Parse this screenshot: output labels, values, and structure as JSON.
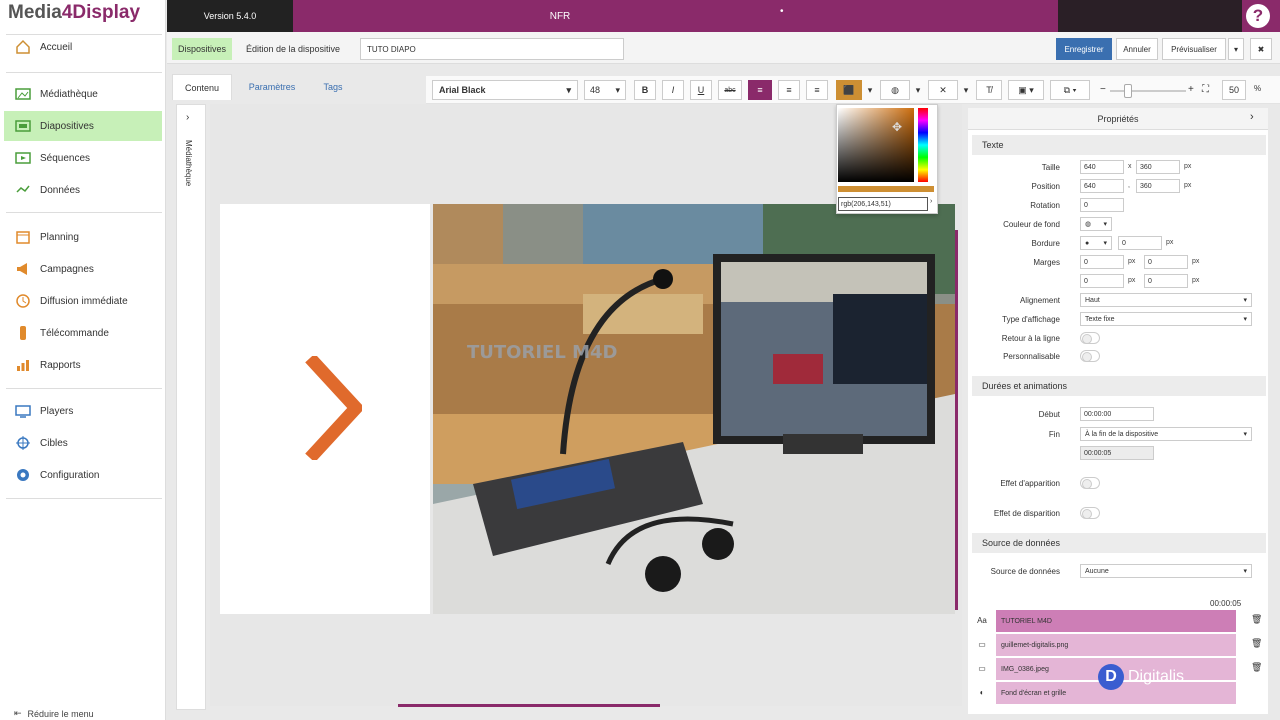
{
  "logo": {
    "part1": "Media",
    "part2": "4Display"
  },
  "version": "Version 5.4.0",
  "center_title": "NFR",
  "center_dot": "•",
  "help": "?",
  "sidebar": {
    "items": [
      {
        "label": "Accueil",
        "icon": "home-icon"
      },
      {
        "label": "Médiathèque",
        "icon": "image-icon"
      },
      {
        "label": "Diapositives",
        "icon": "slides-icon"
      },
      {
        "label": "Séquences",
        "icon": "film-icon"
      },
      {
        "label": "Données",
        "icon": "data-icon"
      },
      {
        "label": "Planning",
        "icon": "calendar-icon"
      },
      {
        "label": "Campagnes",
        "icon": "megaphone-icon"
      },
      {
        "label": "Diffusion immédiate",
        "icon": "clock-icon"
      },
      {
        "label": "Télécommande",
        "icon": "remote-icon"
      },
      {
        "label": "Rapports",
        "icon": "chart-icon"
      },
      {
        "label": "Players",
        "icon": "screen-icon"
      },
      {
        "label": "Cibles",
        "icon": "target-icon"
      },
      {
        "label": "Configuration",
        "icon": "gear-icon"
      }
    ],
    "reduce": "Réduire le menu"
  },
  "breadcrumb": {
    "section": "Dispositives",
    "edit_label": "Édition de la dispositive",
    "slide_name": "TUTO DIAPO"
  },
  "actions": {
    "save": "Enregistrer",
    "cancel": "Annuler",
    "preview": "Prévisualiser",
    "more": "▾",
    "close": "✖"
  },
  "tabs": [
    "Contenu",
    "Paramètres",
    "Tags"
  ],
  "toolbar": {
    "font": "Arial Black",
    "size": "48",
    "zoom": "50",
    "zoom_unit": "%"
  },
  "side_panel_label": "Médiathèque",
  "overlay_text": "TUTORIEL M4D",
  "color_picker": {
    "value": "rgb(206,143,51)",
    "color": "#ce8f33"
  },
  "properties": {
    "title": "Propriétés",
    "text_section": "Texte",
    "size_label": "Taille",
    "width": "640",
    "height": "360",
    "x_sep": "x",
    "unit_px": "px",
    "position_label": "Position",
    "pos_x": "640",
    "pos_y": "360",
    "comma": ",",
    "rotation_label": "Rotation",
    "rotation": "0",
    "bg_label": "Couleur de fond",
    "border_label": "Bordure",
    "border": "0",
    "margins_label": "Marges",
    "m1": "0",
    "m2": "0",
    "m3": "0",
    "m4": "0",
    "align_label": "Alignement",
    "align": "Haut",
    "display_label": "Type d'affichage",
    "display": "Texte fixe",
    "wrap_label": "Retour à la ligne",
    "custom_label": "Personnalisable",
    "anim_section": "Durées et animations",
    "start_label": "Début",
    "start": "00:00:00",
    "end_label": "Fin",
    "end": "À la fin de la dispositive",
    "end_time": "00:00:05",
    "appear_label": "Effet d'apparition",
    "disappear_label": "Effet de disparition",
    "source_section": "Source de données",
    "source_label": "Source de données",
    "source": "Aucune"
  },
  "timeline": {
    "time": "00:00:05",
    "layers": [
      {
        "label": "TUTORIEL M4D",
        "icon": "text-icon"
      },
      {
        "label": "guillemet-digitalis.png",
        "icon": "image-icon"
      },
      {
        "label": "IMG_0386.jpeg",
        "icon": "image-icon"
      },
      {
        "label": "Fond d'écran et grille",
        "icon": "background-icon"
      }
    ]
  },
  "watermark": {
    "letter": "D",
    "text": "Digitalis"
  },
  "colors": {
    "accent": "#8a2a6a",
    "active": "#c7f0b8",
    "save": "#3a6fb0",
    "orange": "#e06a2c"
  }
}
